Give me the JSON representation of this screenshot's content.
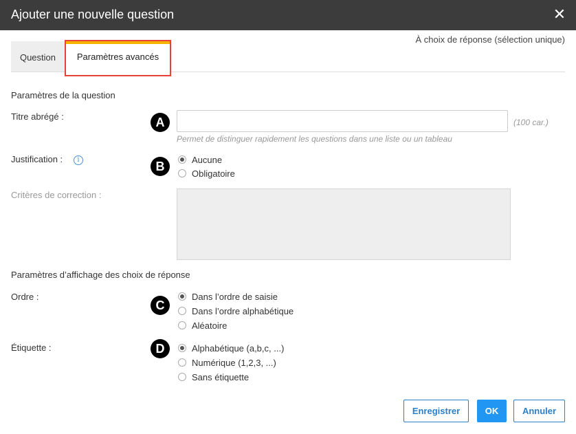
{
  "dialog": {
    "title": "Ajouter une nouvelle question",
    "close_glyph": "✕",
    "question_type": "À choix de réponse (sélection unique)"
  },
  "tabs": [
    {
      "label": "Question",
      "active": false
    },
    {
      "label": "Paramètres avancés",
      "active": true
    }
  ],
  "question_settings": {
    "section_title": "Paramètres de la question",
    "short_title": {
      "label": "Titre abrégé :",
      "value": "",
      "char_limit": "(100 car.)",
      "help": "Permet de distinguer rapidement les questions dans une liste ou un tableau"
    },
    "justification": {
      "label": "Justification :",
      "info_glyph": "i",
      "options": [
        {
          "label": "Aucune",
          "checked": true
        },
        {
          "label": "Obligatoire",
          "checked": false
        }
      ]
    },
    "correction_criteria": {
      "label": "Critères de correction :",
      "value": "",
      "disabled": true
    }
  },
  "display_settings": {
    "section_title": "Paramètres d’affichage des choix de réponse",
    "order": {
      "label": "Ordre :",
      "options": [
        {
          "label": "Dans l’ordre de saisie",
          "checked": true
        },
        {
          "label": "Dans l’ordre alphabétique",
          "checked": false
        },
        {
          "label": "Aléatoire",
          "checked": false
        }
      ]
    },
    "label_type": {
      "label": "Étiquette :",
      "options": [
        {
          "label": "Alphabétique (a,b,c, ...)",
          "checked": true
        },
        {
          "label": "Numérique (1,2,3, ...)",
          "checked": false
        },
        {
          "label": "Sans étiquette",
          "checked": false
        }
      ]
    }
  },
  "markers": [
    "A",
    "B",
    "C",
    "D"
  ],
  "buttons": {
    "save": "Enregistrer",
    "ok": "OK",
    "cancel": "Annuler"
  },
  "colors": {
    "titlebar": "#3c3c3c",
    "tab_highlight": "#e8403a",
    "tab_accent": "#f5b400",
    "primary": "#2196f3",
    "link": "#2a7fc9"
  }
}
